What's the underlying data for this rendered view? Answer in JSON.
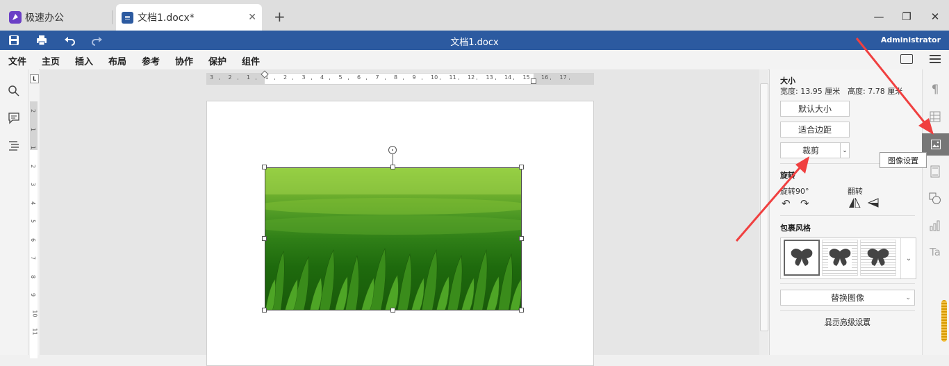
{
  "tabs": {
    "home_label": "极速办公",
    "doc_label": "文档1.docx*",
    "add_icon": "plus-icon"
  },
  "titlebar": {
    "title": "文档1.docx",
    "user": "Administrator"
  },
  "menu": [
    "文件",
    "主页",
    "插入",
    "布局",
    "参考",
    "协作",
    "保护",
    "组件"
  ],
  "ruler": {
    "h_ticks": [
      "3",
      "2",
      "1",
      "1",
      "2",
      "3",
      "4",
      "5",
      "6",
      "7",
      "8",
      "9",
      "10",
      "11",
      "12",
      "13",
      "14",
      "15",
      "16",
      "17"
    ],
    "v_ticks": [
      "2",
      "1",
      "1",
      "2",
      "3",
      "4",
      "5",
      "6",
      "7",
      "8",
      "9",
      "10",
      "11"
    ]
  },
  "panel": {
    "size_title": "大小",
    "width_label": "宽度: 13.95 厘米",
    "height_label": "高度: 7.78 厘米",
    "default_size": "默认大小",
    "fit_margin": "适合边距",
    "crop": "裁剪",
    "rotate_title": "旋转",
    "rotate90": "旋转90°",
    "flip": "翻转",
    "wrap_title": "包裹风格",
    "replace_image": "替换图像",
    "advanced": "显示高级设置"
  },
  "tooltip": "图像设置",
  "colors": {
    "accent": "#2c5aa0",
    "arrow": "#f04040"
  }
}
